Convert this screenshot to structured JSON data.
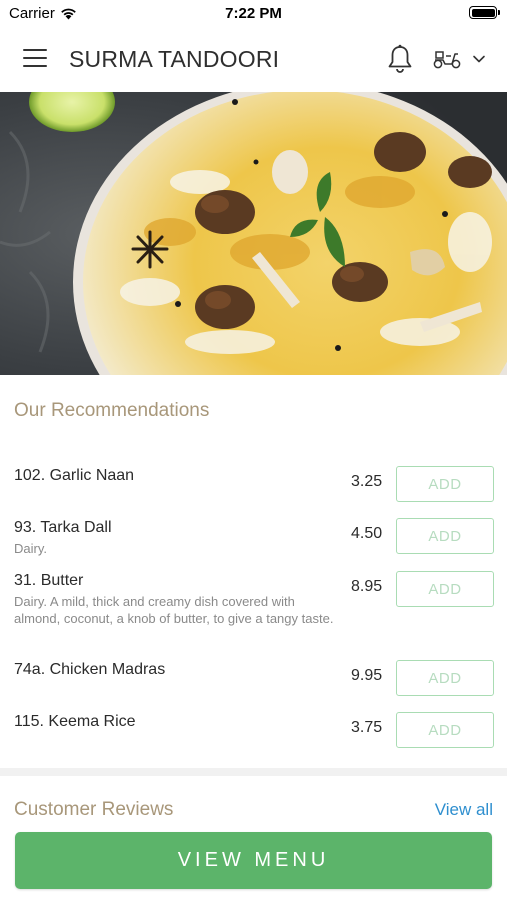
{
  "status": {
    "carrier": "Carrier",
    "time": "7:22 PM"
  },
  "header": {
    "title": "SURMA TANDOORI"
  },
  "recommendations": {
    "title": "Our Recommendations",
    "add_label": "ADD",
    "items": [
      {
        "name": "102. Garlic Naan",
        "description": "",
        "price": "3.25"
      },
      {
        "name": "93. Tarka Dall",
        "description": "Dairy.",
        "price": "4.50"
      },
      {
        "name": "31. Butter",
        "description": "Dairy. A mild, thick and creamy dish covered with almond, coconut, a knob of butter, to give a tangy taste.",
        "price": "8.95"
      },
      {
        "name": "74a. Chicken Madras",
        "description": "",
        "price": "9.95"
      },
      {
        "name": "115. Keema Rice",
        "description": "",
        "price": "3.75"
      }
    ]
  },
  "reviews": {
    "title": "Customer Reviews",
    "view_all": "View all"
  },
  "footer": {
    "view_menu": "VIEW MENU"
  },
  "colors": {
    "accent_green": "#5cb46a",
    "link_blue": "#2f8fcf",
    "section_title": "#a8977a",
    "add_border": "#a9dcb3"
  }
}
